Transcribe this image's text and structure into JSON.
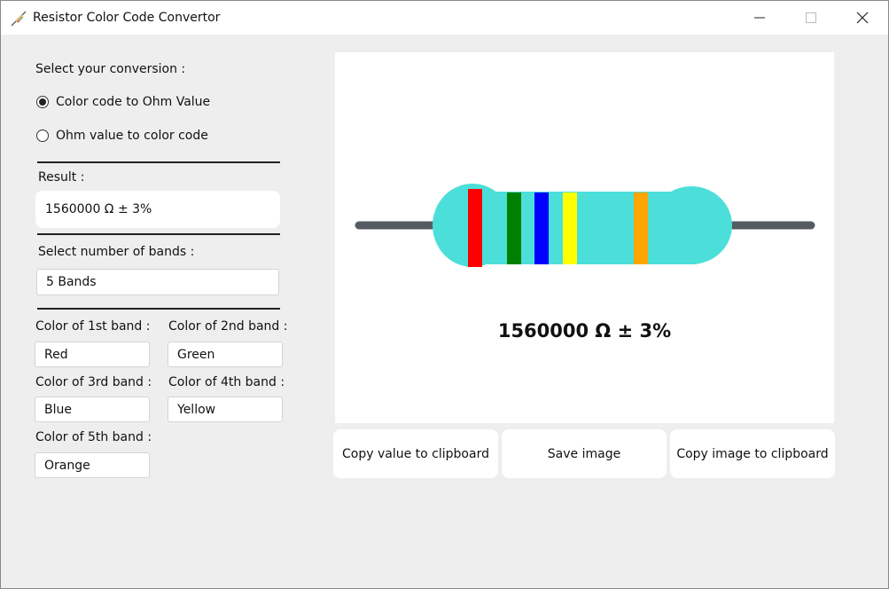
{
  "window": {
    "title": "Resistor Color Code Convertor",
    "app_icon": "resistor-icon",
    "controls": [
      "minimize-icon",
      "maximize-icon",
      "close-icon"
    ]
  },
  "conversion": {
    "label": "Select your conversion :",
    "options": [
      "Color code to Ohm Value",
      "Ohm value to color code"
    ],
    "selected": "Color code to Ohm Value"
  },
  "result": {
    "label": "Result :",
    "value": "1560000 Ω ± 3%"
  },
  "bands_select": {
    "label": "Select number of bands :",
    "value": "5 Bands"
  },
  "band_colors": [
    {
      "label": "Color of 1st band  :",
      "value": "Red"
    },
    {
      "label": "Color of 2nd band :",
      "value": "Green"
    },
    {
      "label": "Color of 3rd band :",
      "value": "Blue"
    },
    {
      "label": "Color of 4th band :",
      "value": "Yellow"
    },
    {
      "label": "Color of 5th band :",
      "value": "Orange"
    }
  ],
  "preview": {
    "value_text": "1560000 Ω ± 3%",
    "body_color": "#4cdfda",
    "lead_color": "#555b63",
    "band_colors": [
      "#ff0000",
      "#008000",
      "#0000ff",
      "#ffff00",
      "#ffa500"
    ]
  },
  "buttons": {
    "copy_value": "Copy value to clipboard",
    "save_image": "Save image",
    "copy_image": "Copy image to clipboard"
  }
}
